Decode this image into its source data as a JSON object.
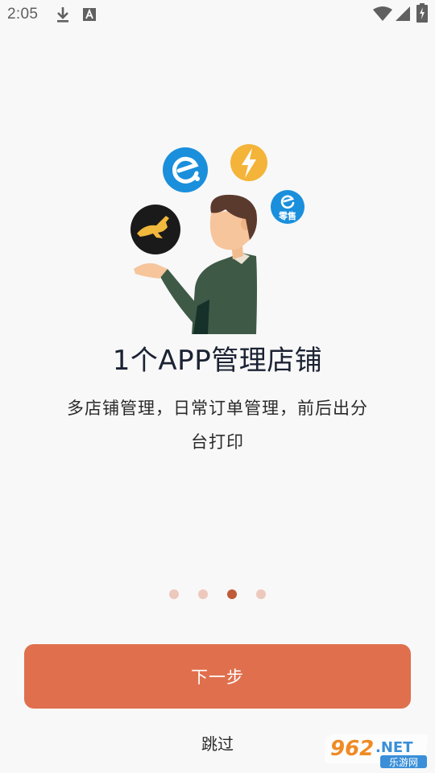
{
  "status_bar": {
    "time": "2:05",
    "icons": [
      "download-icon",
      "keyboard-a-icon",
      "wifi-icon",
      "signal-icon",
      "battery-charging-icon"
    ]
  },
  "illustration": {
    "logos": [
      "eleme-icon",
      "lightning-icon",
      "eleme-retail-icon",
      "kangaroo-icon"
    ],
    "retail_badge_text": "零售"
  },
  "slide": {
    "title": "1个APP管理店铺",
    "description_line1": "多店铺管理，日常订单管理，前后出分",
    "description_line2": "台打印"
  },
  "pager": {
    "total": 4,
    "active_index": 2
  },
  "buttons": {
    "next": "下一步",
    "skip": "跳过"
  },
  "watermark": {
    "number": "962",
    "suffix": ".NET",
    "site": "乐游网"
  },
  "colors": {
    "primary": "#e06f4d",
    "dot_inactive": "#ecc8bd",
    "dot_active": "#c05a38",
    "eleme_blue": "#1a8fdc",
    "lightning_yellow": "#f4b43a"
  }
}
